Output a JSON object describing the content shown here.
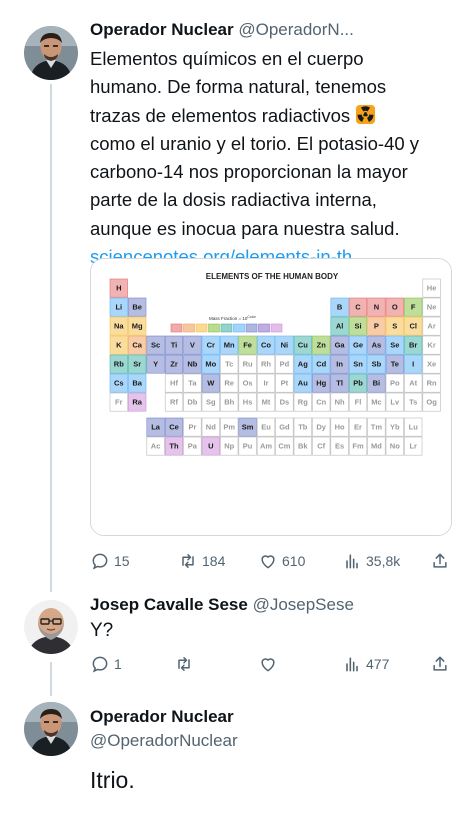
{
  "tweet1": {
    "author_name": "Operador Nuclear",
    "author_handle": "@OperadorN...",
    "text_line1": "Elementos químicos en el cuerpo",
    "text_line2": "humano. De forma natural, tenemos",
    "text_line3": "trazas de elementos radiactivos",
    "text_line4": "como el uranio y el torio. El potasio-40 y",
    "text_line5": "carbono-14 nos proporcionan la mayor",
    "text_line6": "parte de la dosis radiactiva interna,",
    "text_line7": "aunque es inocua para nuestra salud.",
    "link": "sciencenotes.org/elements-in-th...",
    "emoji": "radioactive-emoji",
    "media": {
      "title": "ELEMENTS OF THE HUMAN BODY",
      "legend_label": "Mass Fraction = 10",
      "legend_superscript": "Color",
      "main_table": [
        [
          "H",
          "",
          "",
          "",
          "",
          "",
          "",
          "",
          "",
          "",
          "",
          "",
          "",
          "",
          "",
          "",
          "",
          "He"
        ],
        [
          "Li",
          "Be",
          "",
          "",
          "",
          "",
          "",
          "",
          "",
          "",
          "",
          "",
          "B",
          "C",
          "N",
          "O",
          "F",
          "Ne"
        ],
        [
          "Na",
          "Mg",
          "",
          "",
          "",
          "",
          "",
          "",
          "",
          "",
          "",
          "",
          "Al",
          "Si",
          "P",
          "S",
          "Cl",
          "Ar"
        ],
        [
          "K",
          "Ca",
          "Sc",
          "Ti",
          "V",
          "Cr",
          "Mn",
          "Fe",
          "Co",
          "Ni",
          "Cu",
          "Zn",
          "Ga",
          "Ge",
          "As",
          "Se",
          "Br",
          "Kr"
        ],
        [
          "Rb",
          "Sr",
          "Y",
          "Zr",
          "Nb",
          "Mo",
          "Tc",
          "Ru",
          "Rh",
          "Pd",
          "Ag",
          "Cd",
          "In",
          "Sn",
          "Sb",
          "Te",
          "I",
          "Xe"
        ],
        [
          "Cs",
          "Ba",
          "",
          "Hf",
          "Ta",
          "W",
          "Re",
          "Os",
          "Ir",
          "Pt",
          "Au",
          "Hg",
          "Tl",
          "Pb",
          "Bi",
          "Po",
          "At",
          "Rn"
        ],
        [
          "Fr",
          "Ra",
          "",
          "Rf",
          "Db",
          "Sg",
          "Bh",
          "Hs",
          "Mt",
          "Ds",
          "Rg",
          "Cn",
          "Nh",
          "Fl",
          "Mc",
          "Lv",
          "Ts",
          "Og"
        ]
      ],
      "lanthanides": [
        "La",
        "Ce",
        "Pr",
        "Nd",
        "Pm",
        "Sm",
        "Eu",
        "Gd",
        "Tb",
        "Dy",
        "Ho",
        "Er",
        "Tm",
        "Yb",
        "Lu"
      ],
      "actinides": [
        "Ac",
        "Th",
        "Pa",
        "U",
        "Np",
        "Pu",
        "Am",
        "Cm",
        "Bk",
        "Cf",
        "Es",
        "Fm",
        "Md",
        "No",
        "Lr"
      ],
      "present_colors": {
        "H": "#e57373",
        "O": "#e57373",
        "C": "#e57373",
        "N": "#e57373",
        "Ca": "#f0a35e",
        "P": "#f0a35e",
        "K": "#f4c14e",
        "S": "#f4c14e",
        "Na": "#f4c14e",
        "Cl": "#f4c14e",
        "Mg": "#f4c14e",
        "Fe": "#8bc34a",
        "F": "#8bc34a",
        "Zn": "#8bc34a",
        "Si": "#8bc34a",
        "Rb": "#4db6ac",
        "Sr": "#4db6ac",
        "Br": "#4db6ac",
        "Pb": "#4db6ac",
        "Cu": "#4db6ac",
        "Al": "#4db6ac",
        "Cd": "#64b5f6",
        "B": "#64b5f6",
        "Ba": "#64b5f6",
        "Sn": "#64b5f6",
        "Mn": "#64b5f6",
        "I": "#64b5f6",
        "Ni": "#64b5f6",
        "Au": "#64b5f6",
        "Mo": "#64b5f6",
        "Se": "#64b5f6",
        "Cr": "#64b5f6",
        "Cs": "#64b5f6",
        "Co": "#64b5f6",
        "Li": "#64b5f6",
        "Ag": "#64b5f6",
        "Ge": "#64b5f6",
        "Sb": "#64b5f6",
        "Ti": "#7986cb",
        "As": "#7986cb",
        "Hg": "#7986cb",
        "Zr": "#7986cb",
        "Ga": "#7986cb",
        "Te": "#7986cb",
        "Bi": "#7986cb",
        "Y": "#7986cb",
        "Nb": "#7986cb",
        "V": "#7986cb",
        "Ce": "#7986cb",
        "Be": "#7986cb",
        "La": "#7986cb",
        "Tl": "#7986cb",
        "W": "#7986cb",
        "Sc": "#7986cb",
        "Sm": "#7986cb",
        "In": "#7986cb",
        "Ra": "#ce93d8",
        "Th": "#ce93d8",
        "U": "#ce93d8"
      },
      "legend_colors": [
        "#e57373",
        "#f0a35e",
        "#f4c14e",
        "#8bc34a",
        "#4db6ac",
        "#64b5f6",
        "#7986cb",
        "#9575cd",
        "#ce93d8"
      ]
    },
    "actions": {
      "replies": "15",
      "retweets": "184",
      "likes": "610",
      "views": "35,8k"
    }
  },
  "tweet2": {
    "author_name": "Josep Cavalle Sese",
    "author_handle": "@JosepSese",
    "text": "Y?",
    "actions": {
      "replies": "1",
      "retweets": "",
      "likes": "",
      "views": "477"
    }
  },
  "tweet3": {
    "author_name": "Operador Nuclear",
    "author_handle": "@OperadorNuclear",
    "text": "Itrio."
  },
  "colors": {
    "link": "#1d9bf0",
    "secondary_text": "#536471",
    "thread_line": "#cfd9de"
  }
}
